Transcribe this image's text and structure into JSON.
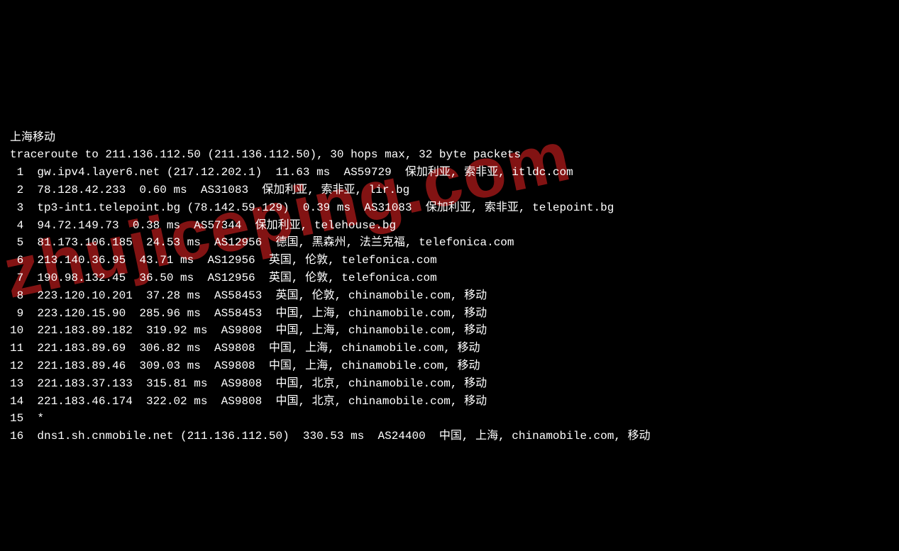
{
  "title": "上海移动",
  "header": "traceroute to 211.136.112.50 (211.136.112.50), 30 hops max, 32 byte packets",
  "watermark": "zhujiceping.com",
  "hops": [
    {
      "n": "1",
      "line": "gw.ipv4.layer6.net (217.12.202.1)  11.63 ms  AS59729  保加利亚, 索非亚, itldc.com"
    },
    {
      "n": "2",
      "line": "78.128.42.233  0.60 ms  AS31083  保加利亚, 索非亚, lir.bg"
    },
    {
      "n": "3",
      "line": "tp3-int1.telepoint.bg (78.142.59.129)  0.39 ms  AS31083  保加利亚, 索非亚, telepoint.bg"
    },
    {
      "n": "4",
      "line": "94.72.149.73  0.38 ms  AS57344  保加利亚, telehouse.bg"
    },
    {
      "n": "5",
      "line": "81.173.106.185  24.53 ms  AS12956  德国, 黑森州, 法兰克福, telefonica.com"
    },
    {
      "n": "6",
      "line": "213.140.36.95  43.71 ms  AS12956  英国, 伦敦, telefonica.com"
    },
    {
      "n": "7",
      "line": "190.98.132.45  36.50 ms  AS12956  英国, 伦敦, telefonica.com"
    },
    {
      "n": "8",
      "line": "223.120.10.201  37.28 ms  AS58453  英国, 伦敦, chinamobile.com, 移动"
    },
    {
      "n": "9",
      "line": "223.120.15.90  285.96 ms  AS58453  中国, 上海, chinamobile.com, 移动"
    },
    {
      "n": "10",
      "line": "221.183.89.182  319.92 ms  AS9808  中国, 上海, chinamobile.com, 移动"
    },
    {
      "n": "11",
      "line": "221.183.89.69  306.82 ms  AS9808  中国, 上海, chinamobile.com, 移动"
    },
    {
      "n": "12",
      "line": "221.183.89.46  309.03 ms  AS9808  中国, 上海, chinamobile.com, 移动"
    },
    {
      "n": "13",
      "line": "221.183.37.133  315.81 ms  AS9808  中国, 北京, chinamobile.com, 移动"
    },
    {
      "n": "14",
      "line": "221.183.46.174  322.02 ms  AS9808  中国, 北京, chinamobile.com, 移动"
    },
    {
      "n": "15",
      "line": "*"
    },
    {
      "n": "16",
      "line": "dns1.sh.cnmobile.net (211.136.112.50)  330.53 ms  AS24400  中国, 上海, chinamobile.com, 移动"
    }
  ]
}
